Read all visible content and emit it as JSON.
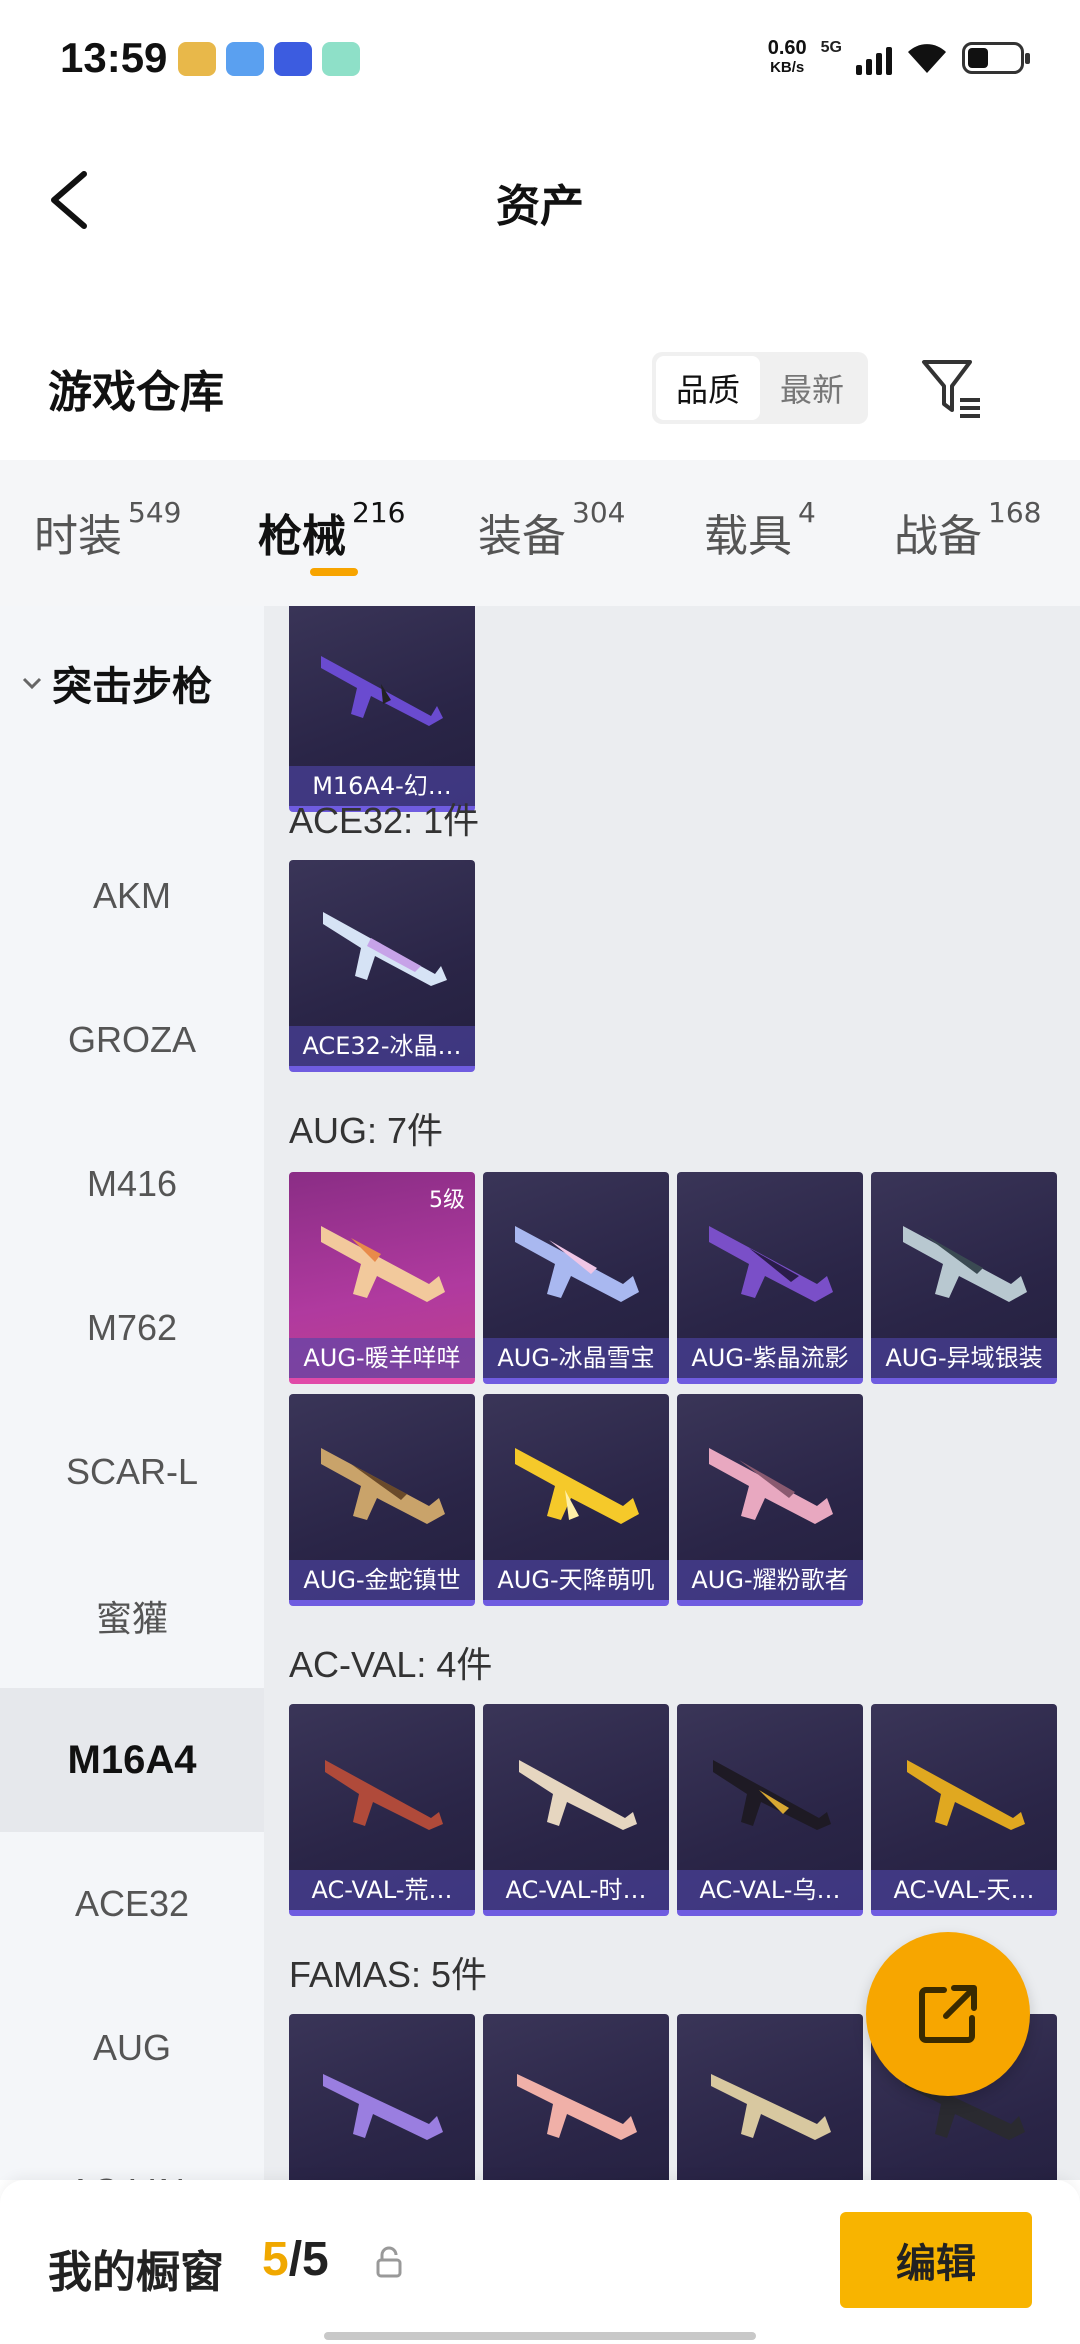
{
  "status": {
    "time": "13:59",
    "speed_value": "0.60",
    "speed_unit": "KB/s",
    "network": "5G"
  },
  "header": {
    "title": "资产"
  },
  "warehouse": {
    "title": "游戏仓库",
    "sort_quality": "品质",
    "sort_newest": "最新"
  },
  "tabs": [
    {
      "label": "时装",
      "count": "549"
    },
    {
      "label": "枪械",
      "count": "216"
    },
    {
      "label": "装备",
      "count": "304"
    },
    {
      "label": "载具",
      "count": "4"
    },
    {
      "label": "战备",
      "count": "168"
    }
  ],
  "sidebar": {
    "group": "突击步枪",
    "items": [
      "AKM",
      "GROZA",
      "M416",
      "M762",
      "SCAR-L",
      "蜜獾",
      "M16A4",
      "ACE32",
      "AUG",
      "AC-VAL"
    ]
  },
  "sections": {
    "m16": {
      "items": [
        "M16A4-幻…"
      ]
    },
    "ace32": {
      "title": "ACE32: 1件",
      "items": [
        "ACE32-冰晶…"
      ]
    },
    "aug": {
      "title": "AUG: 7件",
      "level_badge": "5级",
      "items": [
        "AUG-暖羊咩咩",
        "AUG-冰晶雪宝",
        "AUG-紫晶流影",
        "AUG-异域银装",
        "AUG-金蛇镇世",
        "AUG-天降萌叽",
        "AUG-耀粉歌者"
      ]
    },
    "acval": {
      "title": "AC-VAL: 4件",
      "items": [
        "AC-VAL-荒…",
        "AC-VAL-时…",
        "AC-VAL-乌…",
        "AC-VAL-天…"
      ]
    },
    "famas": {
      "title": "FAMAS: 5件"
    }
  },
  "bottom": {
    "label": "我的橱窗",
    "current": "5",
    "total": "/5",
    "edit": "编辑"
  },
  "colors": {
    "accent": "#f7a600",
    "card_purple": "#2a2547",
    "card_pink": "#b03a9f"
  }
}
